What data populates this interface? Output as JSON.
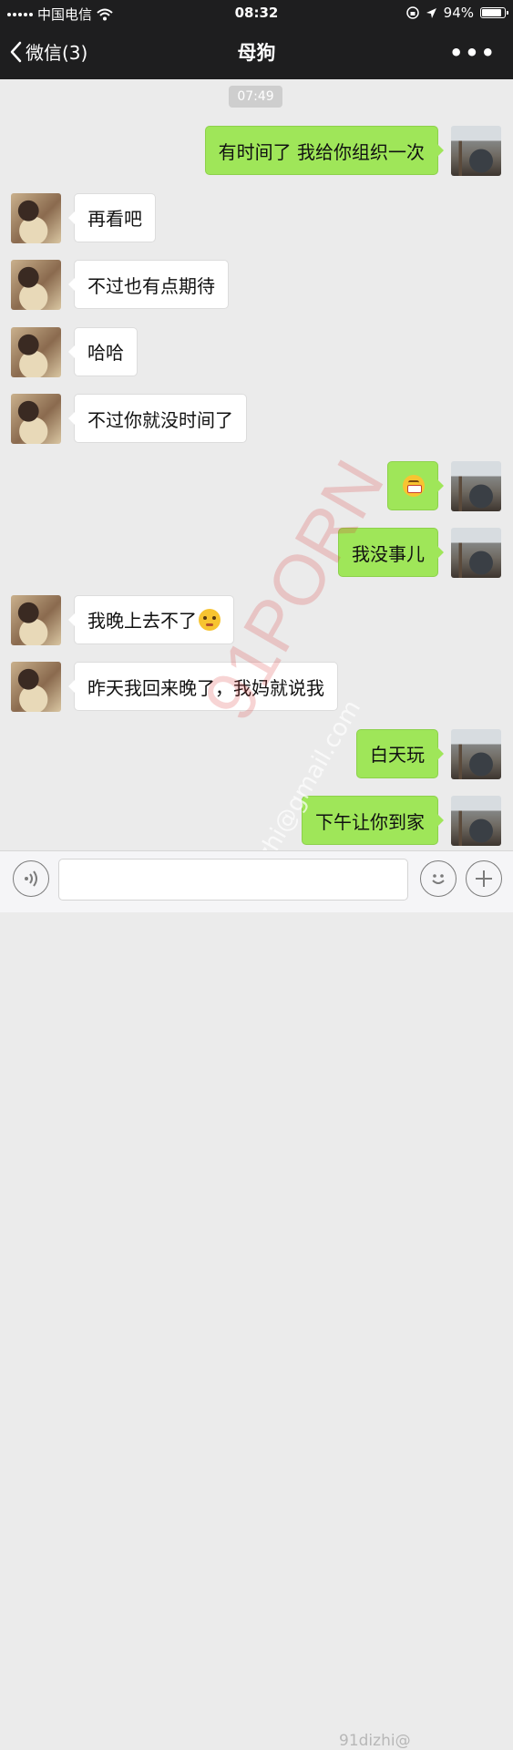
{
  "status_bar": {
    "carrier": "中国电信",
    "time": "08:32",
    "battery": "94%",
    "battery_level": 0.94
  },
  "nav": {
    "back_label": "微信(3)",
    "title": "母狗",
    "more_label": "•••"
  },
  "chat": {
    "timestamp": "07:49",
    "messages": [
      {
        "side": "out",
        "text": "有时间了 我给你组织一次"
      },
      {
        "side": "in",
        "text": "再看吧"
      },
      {
        "side": "in",
        "text": "不过也有点期待"
      },
      {
        "side": "in",
        "text": "哈哈"
      },
      {
        "side": "in",
        "text": "不过你就没时间了"
      },
      {
        "side": "out",
        "text": "",
        "emoji": "grin-emoji"
      },
      {
        "side": "out",
        "text": "我没事儿"
      },
      {
        "side": "in",
        "text": "我晚上去不了",
        "emoji": "sad-emoji"
      },
      {
        "side": "in",
        "text": "昨天我回来晚了，我妈就说我"
      },
      {
        "side": "out",
        "text": "白天玩"
      },
      {
        "side": "out",
        "text": "下午让你到家"
      }
    ]
  },
  "watermark": {
    "main": "91PORN",
    "email": "91dizhi@gmail.com",
    "bottom": "91dizhi@"
  },
  "colors": {
    "header_bg": "#1e1e1f",
    "chat_bg": "#ebebeb",
    "outgoing_bubble": "#9fe659",
    "incoming_bubble": "#ffffff"
  }
}
